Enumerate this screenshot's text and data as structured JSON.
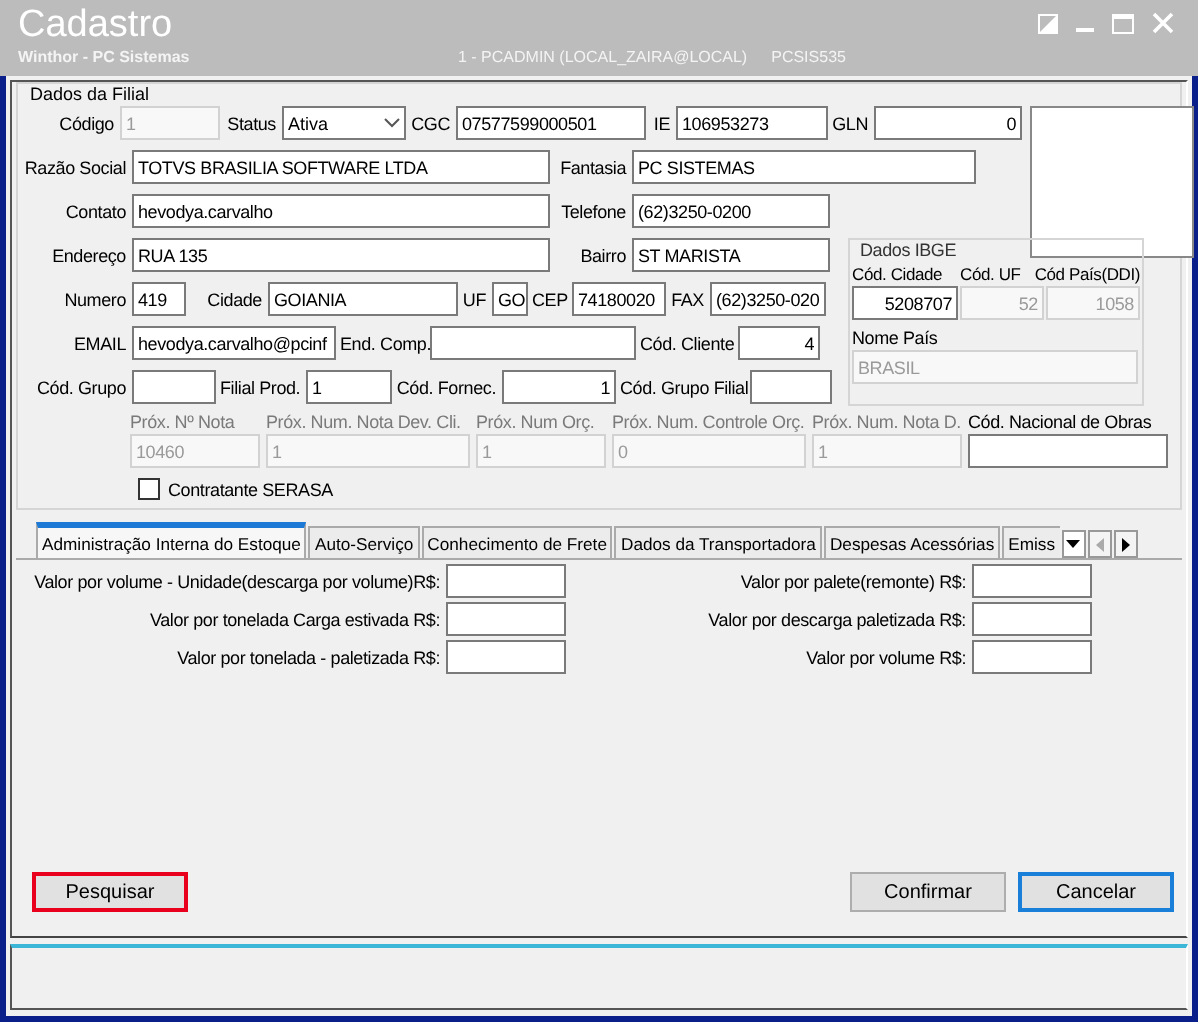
{
  "window": {
    "title": "Cadastro",
    "subtitle": "Winthor - PC Sistemas",
    "session": "1 - PCADMIN (LOCAL_ZAIRA@LOCAL)",
    "program": "PCSIS535"
  },
  "group": {
    "title": "Dados da Filial"
  },
  "rows_top": [
    [
      {
        "label": "Código",
        "value": "1",
        "kind": "text",
        "disabled": true
      },
      {
        "label": "Status",
        "value": "Ativa",
        "kind": "select",
        "disabled": false
      },
      {
        "label": "CGC",
        "value": "07577599000501",
        "kind": "text",
        "disabled": false
      },
      {
        "label": "IE",
        "value": "106953273",
        "kind": "text",
        "disabled": false
      },
      {
        "label": "GLN",
        "value": "0",
        "kind": "number",
        "disabled": false
      }
    ],
    [
      {
        "label": "Razão Social",
        "value": "TOTVS BRASILIA SOFTWARE LTDA",
        "kind": "text",
        "disabled": false
      },
      {
        "label": "Fantasia",
        "value": "PC SISTEMAS",
        "kind": "text",
        "disabled": false
      }
    ],
    [
      {
        "label": "Contato",
        "value": "hevodya.carvalho",
        "kind": "text",
        "disabled": false
      },
      {
        "label": "Telefone",
        "value": "(62)3250-0200",
        "kind": "text",
        "disabled": false
      }
    ]
  ],
  "rows_mid": [
    [
      {
        "label": "Endereço",
        "value": "RUA 135",
        "kind": "text",
        "disabled": false
      },
      {
        "label": "Bairro",
        "value": "ST MARISTA",
        "kind": "text",
        "disabled": false
      }
    ],
    [
      {
        "label": "Numero",
        "value": "419",
        "kind": "text",
        "disabled": false
      },
      {
        "label": "Cidade",
        "value": "GOIANIA",
        "kind": "text",
        "disabled": false
      },
      {
        "label": "UF",
        "value": "GO",
        "kind": "text",
        "disabled": false
      },
      {
        "label": "CEP",
        "value": "74180020",
        "kind": "text",
        "disabled": false
      },
      {
        "label": "FAX",
        "value": "(62)3250-020",
        "kind": "text",
        "disabled": false
      }
    ],
    [
      {
        "label": "EMAIL",
        "value": "hevodya.carvalho@pcinf",
        "kind": "text",
        "disabled": false
      },
      {
        "label": "End. Comp.",
        "kind": "text",
        "disabled": false
      },
      {
        "label": "Cód. Cliente",
        "value": "4",
        "kind": "number",
        "disabled": false
      }
    ],
    [
      {
        "label": "Cód. Grupo",
        "kind": "text",
        "disabled": false
      },
      {
        "label": "Filial Prod.",
        "value": "1",
        "kind": "text",
        "disabled": false
      },
      {
        "label": "Cód. Fornec.",
        "value": "1",
        "kind": "number",
        "disabled": false
      },
      {
        "label": "Cód. Grupo Filial",
        "kind": "text",
        "disabled": false
      }
    ]
  ],
  "ibge": {
    "title": "Dados IBGE",
    "fields": [
      {
        "label": "Cód. Cidade",
        "value": "5208707",
        "disabled": false
      },
      {
        "label": "Cód. UF",
        "value": "52",
        "disabled": true
      },
      {
        "label": "Cód País(DDI)",
        "value": "1058",
        "disabled": true
      }
    ],
    "country": {
      "label": "Nome País",
      "value": "BRASIL",
      "disabled": true
    }
  },
  "next_numbers": [
    {
      "label": "Próx. Nº Nota",
      "value": "10460",
      "disabled": true
    },
    {
      "label": "Próx. Num. Nota Dev. Cli.",
      "value": "1",
      "disabled": true
    },
    {
      "label": "Próx. Num Orç.",
      "value": "1",
      "disabled": true
    },
    {
      "label": "Próx. Num. Controle Orç.",
      "value": "0",
      "disabled": true
    },
    {
      "label": "Próx. Num. Nota D.",
      "value": "1",
      "disabled": true
    },
    {
      "label": "Cód. Nacional de Obras",
      "disabled": false
    }
  ],
  "serasa": {
    "label": "Contratante SERASA",
    "checked": false
  },
  "tabs": [
    {
      "label": "Administração Interna do Estoque",
      "selected": true
    },
    {
      "label": "Auto-Serviço",
      "selected": false
    },
    {
      "label": "Conhecimento de Frete",
      "selected": false
    },
    {
      "label": "Dados da Transportadora",
      "selected": false
    },
    {
      "label": "Despesas Acessórias",
      "selected": false
    },
    {
      "label": "Emiss",
      "selected": false
    }
  ],
  "tab_fields": [
    [
      {
        "label": "Valor por volume - Unidade(descarga por volume)R$:"
      },
      {
        "label": "Valor por tonelada Carga estivada R$:"
      },
      {
        "label": "Valor por tonelada - paletizada R$:"
      }
    ],
    [
      {
        "label": "Valor por palete(remonte) R$:"
      },
      {
        "label": "Valor por descarga paletizada R$:"
      },
      {
        "label": "Valor por volume R$:"
      }
    ]
  ],
  "buttons": [
    {
      "label": "Pesquisar",
      "highlighted": true,
      "focused": false
    },
    {
      "label": "Confirmar",
      "highlighted": false,
      "focused": false
    },
    {
      "label": "Cancelar",
      "highlighted": false,
      "focused": true
    }
  ]
}
